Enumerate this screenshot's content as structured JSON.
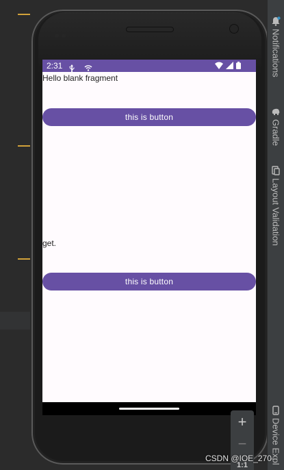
{
  "status_bar": {
    "time": "2:31"
  },
  "screen": {
    "text_top": "Hello blank fragment",
    "button_1": "this is button",
    "text_mid": "get.",
    "button_2": "this is button"
  },
  "tool_windows": [
    {
      "label": "Notifications",
      "icon": "bell-icon"
    },
    {
      "label": "Gradle",
      "icon": "gradle-elephant-icon"
    },
    {
      "label": "Layout Validation",
      "icon": "layout-validation-icon"
    },
    {
      "label": "Device Expl",
      "icon": "device-icon"
    }
  ],
  "zoom": {
    "zoom_in": "+",
    "zoom_out": "−",
    "fit": "1:1"
  },
  "watermark": "CSDN @IOE_270",
  "colors": {
    "accent": "#6750a4",
    "screen_bg": "#fffbfe",
    "ide_bg": "#2b2b2b",
    "guide": "#d2a23a"
  }
}
